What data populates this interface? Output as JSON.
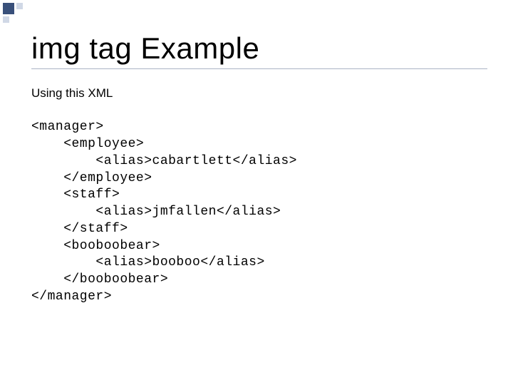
{
  "slide": {
    "title": "img tag Example",
    "subtitle": "Using this XML",
    "code_lines": {
      "l0": "<manager>",
      "l1": "    <employee>",
      "l2": "        <alias>cabartlett</alias>",
      "l3": "    </employee>",
      "l4": "    <staff>",
      "l5": "        <alias>jmfallen</alias>",
      "l6": "    </staff>",
      "l7": "    <booboobear>",
      "l8": "        <alias>booboo</alias>",
      "l9": "    </booboobear>",
      "l10": "</manager>"
    }
  }
}
